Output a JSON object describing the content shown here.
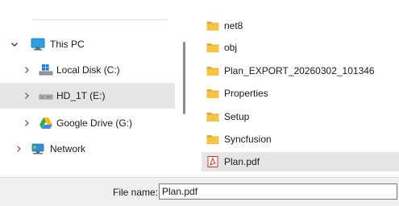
{
  "nav": {
    "items": [
      {
        "label": "This PC",
        "icon": "monitor-icon",
        "chevron": "chevron-down-icon"
      },
      {
        "label": "Local Disk (C:)",
        "icon": "windows-drive-icon",
        "chevron": "chevron-right-icon"
      },
      {
        "label": "HD_1T (E:)",
        "icon": "external-drive-icon",
        "chevron": "chevron-right-icon",
        "selected": true
      },
      {
        "label": "Google Drive (G:)",
        "icon": "google-drive-icon",
        "chevron": "chevron-right-icon"
      },
      {
        "label": "Network",
        "icon": "network-icon",
        "chevron": "chevron-right-icon"
      }
    ]
  },
  "files": {
    "items": [
      {
        "name": "net8",
        "type": "folder"
      },
      {
        "name": "obj",
        "type": "folder"
      },
      {
        "name": "Plan_EXPORT_20260302_101346",
        "type": "folder"
      },
      {
        "name": "Properties",
        "type": "folder"
      },
      {
        "name": "Setup",
        "type": "folder"
      },
      {
        "name": "Syncfusion",
        "type": "folder"
      },
      {
        "name": "Plan.pdf",
        "type": "pdf",
        "selected": true
      }
    ]
  },
  "footer": {
    "file_name_label": "File name:",
    "file_name_value": "Plan.pdf"
  },
  "colors": {
    "folder": "#f6c344",
    "folder_dark": "#e0a82e",
    "selection": "#e5e5e5",
    "pdf_red": "#d9352a"
  }
}
